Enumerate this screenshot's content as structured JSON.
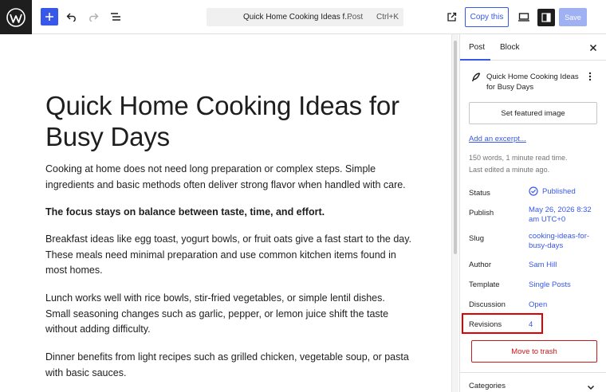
{
  "topbar": {
    "command_title": "Quick Home Cooking Ideas f...",
    "command_type": "· Post",
    "command_shortcut": "Ctrl+K",
    "copy_label": "Copy this",
    "save_label": "Save"
  },
  "editor": {
    "title": "Quick Home Cooking Ideas for Busy Days",
    "paragraphs": [
      "Cooking at home does not need long preparation or complex steps. Simple ingredients and basic methods often deliver strong flavor when handled with care.",
      "The focus stays on balance between taste, time, and effort.",
      "Breakfast ideas like egg toast, yogurt bowls, or fruit oats give a fast start to the day. These meals need minimal preparation and use common kitchen items found in most homes.",
      "Lunch works well with rice bowls, stir-fried vegetables, or simple lentil dishes. Small seasoning changes such as garlic, pepper, or lemon juice shift the taste without adding difficulty.",
      "Dinner benefits from light recipes such as grilled chicken, vegetable soup, or pasta with basic sauces."
    ]
  },
  "sidebar": {
    "tabs": [
      "Post",
      "Block"
    ],
    "post_title": "Quick Home Cooking Ideas for Busy Days",
    "featured_image_label": "Set featured image",
    "excerpt_link": "Add an excerpt...",
    "word_info": "150 words, 1 minute read time.",
    "last_edited": "Last edited a minute ago.",
    "rows": {
      "status": {
        "label": "Status",
        "value": "Published"
      },
      "publish": {
        "label": "Publish",
        "value": "May 26, 2026 8:32 am UTC+0"
      },
      "slug": {
        "label": "Slug",
        "value": "cooking-ideas-for-busy-days"
      },
      "author": {
        "label": "Author",
        "value": "Sam Hill"
      },
      "template": {
        "label": "Template",
        "value": "Single Posts"
      },
      "discussion": {
        "label": "Discussion",
        "value": "Open"
      },
      "revisions": {
        "label": "Revisions",
        "value": "4"
      }
    },
    "trash_label": "Move to trash",
    "categories_label": "Categories"
  },
  "colors": {
    "accent": "#3858e9",
    "highlight": "#e10000",
    "danger": "#cc1818"
  }
}
